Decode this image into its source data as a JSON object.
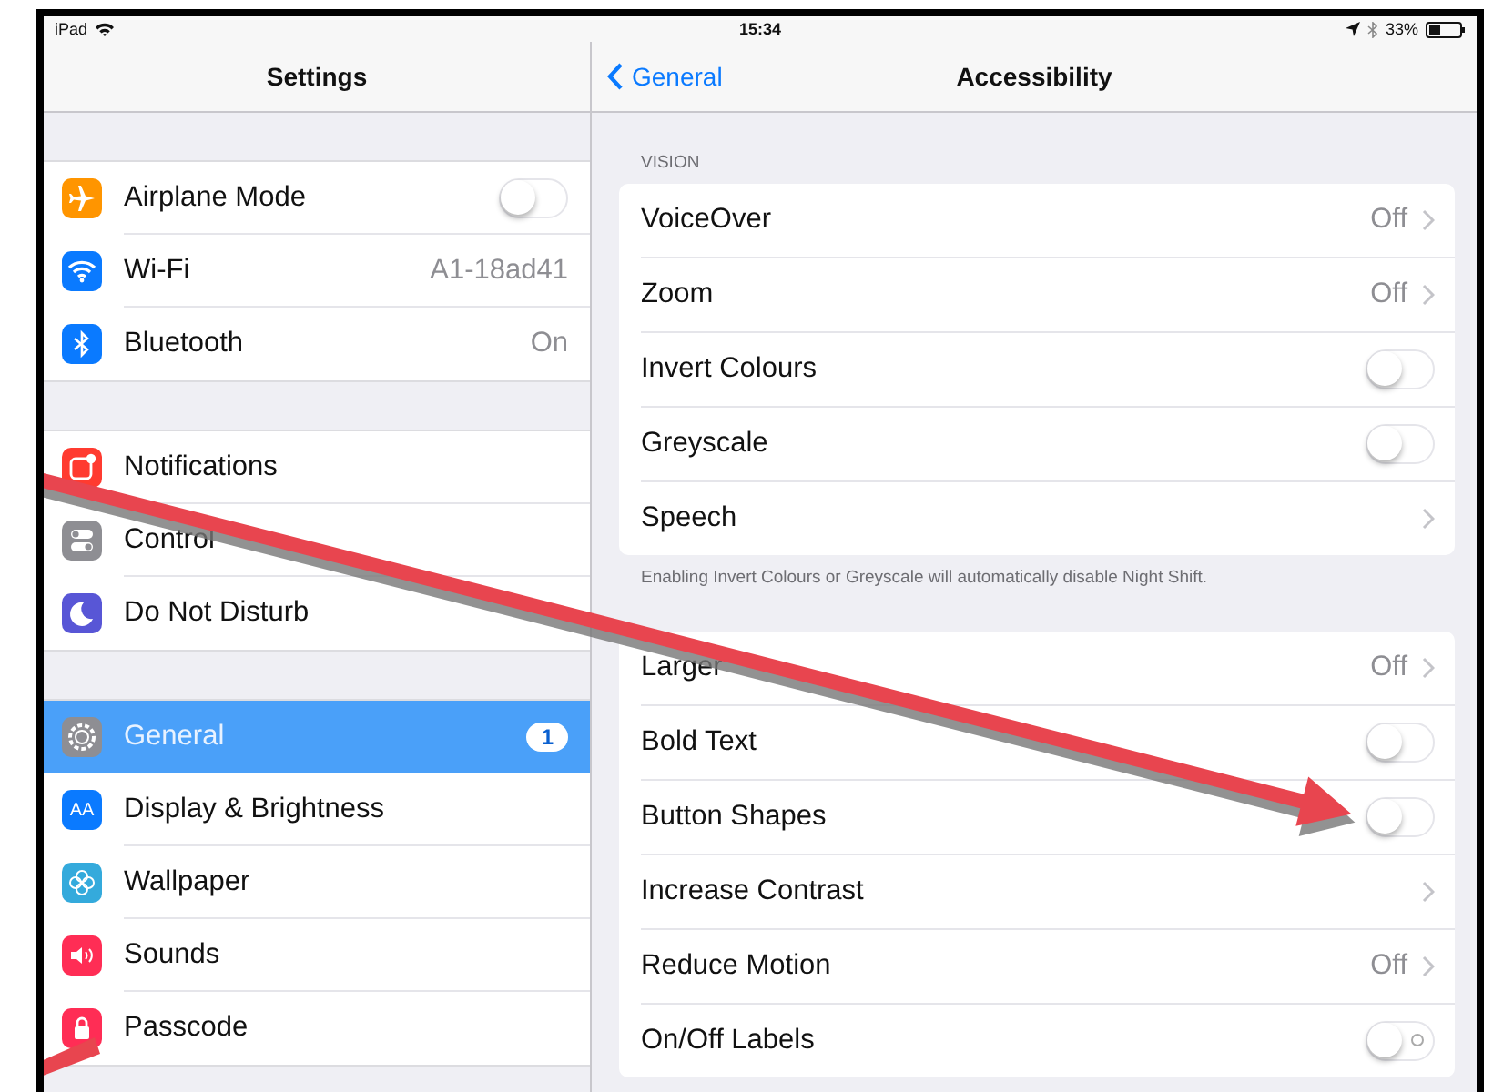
{
  "status_bar": {
    "device": "iPad",
    "time": "15:34",
    "battery": "33%"
  },
  "sidebar": {
    "title": "Settings",
    "groups": [
      [
        {
          "label": "Airplane Mode",
          "kind": "toggle",
          "on": false,
          "color": "#ff9500",
          "selected": false
        },
        {
          "label": "Wi-Fi",
          "kind": "value",
          "value": "A1-18ad41",
          "color": "#0a7aff",
          "selected": false
        },
        {
          "label": "Bluetooth",
          "kind": "value",
          "value": "On",
          "color": "#0a7aff",
          "selected": false
        }
      ],
      [
        {
          "label": "Notifications",
          "kind": "plain",
          "color": "#ff3b30",
          "selected": false
        },
        {
          "label": "Control",
          "kind": "plain",
          "color": "#8e8e93",
          "selected": false
        },
        {
          "label": "Do Not Disturb",
          "kind": "plain",
          "color": "#5856d6",
          "selected": false
        }
      ],
      [
        {
          "label": "General",
          "kind": "badge",
          "badge": "1",
          "color": "#8e8e93",
          "selected": true
        },
        {
          "label": "Display & Brightness",
          "kind": "plain",
          "color": "#0a7aff",
          "icon_text": "AA",
          "selected": false
        },
        {
          "label": "Wallpaper",
          "kind": "plain",
          "color": "#34aadc",
          "selected": false
        },
        {
          "label": "Sounds",
          "kind": "plain",
          "color": "#ff2d55",
          "selected": false
        },
        {
          "label": "Passcode",
          "kind": "plain",
          "color": "#ff2d55",
          "selected": false
        }
      ]
    ]
  },
  "detail": {
    "back": "General",
    "title": "Accessibility",
    "sections": [
      {
        "header": "VISION",
        "rows": [
          {
            "label": "VoiceOver",
            "kind": "disclosure",
            "value": "Off"
          },
          {
            "label": "Zoom",
            "kind": "disclosure",
            "value": "Off"
          },
          {
            "label": "Invert Colours",
            "kind": "toggle",
            "on": false
          },
          {
            "label": "Greyscale",
            "kind": "toggle",
            "on": false
          },
          {
            "label": "Speech",
            "kind": "disclosure"
          }
        ],
        "footer": "Enabling Invert Colours or Greyscale will automatically disable Night Shift."
      },
      {
        "rows": [
          {
            "label": "Larger",
            "kind": "disclosure",
            "value": "Off"
          },
          {
            "label": "Bold Text",
            "kind": "toggle",
            "on": false
          },
          {
            "label": "Button Shapes",
            "kind": "toggle",
            "on": false
          },
          {
            "label": "Increase Contrast",
            "kind": "disclosure"
          },
          {
            "label": "Reduce Motion",
            "kind": "disclosure",
            "value": "Off"
          },
          {
            "label": "On/Off Labels",
            "kind": "toggle",
            "on": false,
            "labels": true
          }
        ]
      }
    ]
  }
}
